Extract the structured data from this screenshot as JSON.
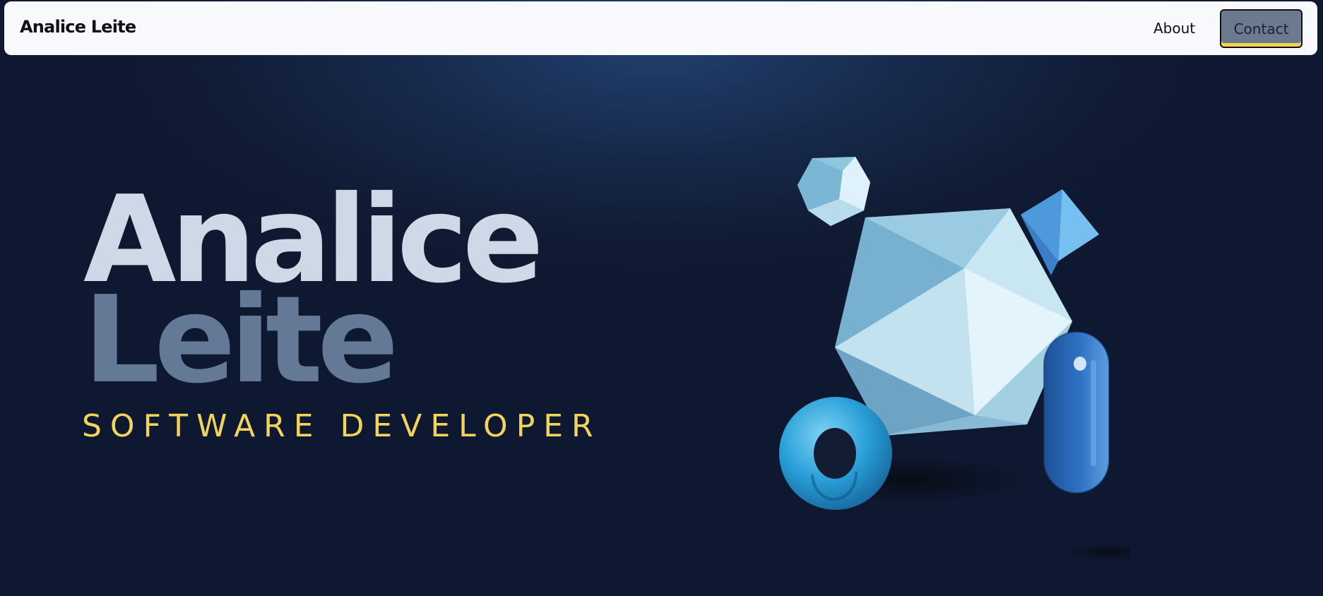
{
  "nav": {
    "brand": "Analice Leite",
    "about_label": "About",
    "contact_label": "Contact"
  },
  "hero": {
    "first_name": "Analice",
    "last_name": "Leite",
    "role": "SOFTWARE DEVELOPER"
  },
  "colors": {
    "background": "#101b33",
    "name_primary": "#cfd8e6",
    "name_secondary": "#647995",
    "role_accent": "#f3d45a",
    "contact_button": "#6c7a91"
  },
  "art": {
    "shapes": [
      "dodecahedron-shape",
      "icosahedron-shape",
      "octahedron-shape",
      "torus-shape",
      "capsule-shape"
    ]
  }
}
